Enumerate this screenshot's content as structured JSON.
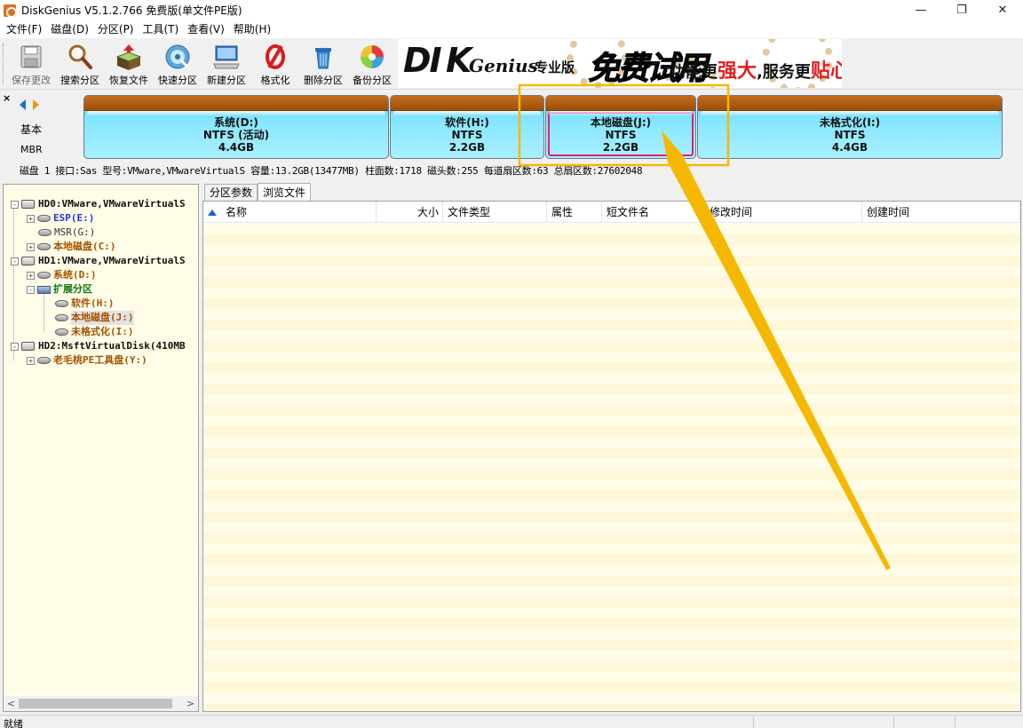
{
  "window": {
    "title": "DiskGenius V5.1.2.766 免费版(单文件PE版)",
    "controls": {
      "minimize": "—",
      "maximize": "❐",
      "close": "✕"
    }
  },
  "menu": [
    "文件(F)",
    "磁盘(D)",
    "分区(P)",
    "工具(T)",
    "查看(V)",
    "帮助(H)"
  ],
  "toolbar": {
    "items": [
      {
        "label": "保存更改",
        "icon": "save-icon",
        "enabled": false
      },
      {
        "label": "搜索分区",
        "icon": "magnifier-icon",
        "enabled": true
      },
      {
        "label": "恢复文件",
        "icon": "recover-box-icon",
        "enabled": true
      },
      {
        "label": "快速分区",
        "icon": "disc-icon",
        "enabled": true
      },
      {
        "label": "新建分区",
        "icon": "computer-icon",
        "enabled": true
      },
      {
        "label": "格式化",
        "icon": "format-icon",
        "enabled": true
      },
      {
        "label": "删除分区",
        "icon": "trash-icon",
        "enabled": true
      },
      {
        "label": "备份分区",
        "icon": "pie-icon",
        "enabled": true
      }
    ]
  },
  "banner": {
    "logo_di": "DI",
    "logo_k": "K",
    "logo_genius": "Genius",
    "edition": "专业版",
    "trial": "免费试用",
    "slogan_a": "功能更",
    "slogan_b": "强大",
    "slogan_c": ",服务更",
    "slogan_d": "贴心"
  },
  "disk_map": {
    "close": "×",
    "type": "基本",
    "style": "MBR",
    "partitions": [
      {
        "name": "系统(D:)",
        "fs": "NTFS (活动)",
        "size": "4.4GB",
        "selected": false
      },
      {
        "name": "软件(H:)",
        "fs": "NTFS",
        "size": "2.2GB",
        "selected": false
      },
      {
        "name": "本地磁盘(J:)",
        "fs": "NTFS",
        "size": "2.2GB",
        "selected": true
      },
      {
        "name": "未格式化(I:)",
        "fs": "NTFS",
        "size": "4.4GB",
        "selected": false
      }
    ],
    "info_line": "磁盘 1 接口:Sas  型号:VMware,VMwareVirtualS  容量:13.2GB(13477MB)  柱面数:1718  磁头数:255  每道扇区数:63  总扇区数:27602048"
  },
  "tree": [
    {
      "label": "HD0:VMware,VMwareVirtualS",
      "color": "black",
      "icon": "disk",
      "exp": "-"
    },
    {
      "label": "ESP(E:)",
      "color": "blue",
      "icon": "part",
      "exp": "+"
    },
    {
      "label": "MSR(G:)",
      "color": "gray",
      "icon": "part",
      "exp": ""
    },
    {
      "label": "本地磁盘(C:)",
      "color": "brown",
      "icon": "part",
      "exp": "+"
    },
    {
      "label": "HD1:VMware,VMwareVirtualS",
      "color": "black",
      "icon": "disk",
      "exp": "-"
    },
    {
      "label": "系统(D:)",
      "color": "brown",
      "icon": "part",
      "exp": "+"
    },
    {
      "label": "扩展分区",
      "color": "green",
      "icon": "ext",
      "exp": "-"
    },
    {
      "label": "软件(H:)",
      "color": "brown",
      "icon": "part",
      "exp": ""
    },
    {
      "label": "本地磁盘(J:)",
      "color": "brown",
      "icon": "part",
      "exp": "",
      "selected": true
    },
    {
      "label": "未格式化(I:)",
      "color": "brown",
      "icon": "part",
      "exp": ""
    },
    {
      "label": "HD2:MsftVirtualDisk(410MB",
      "color": "black",
      "icon": "disk",
      "exp": "-"
    },
    {
      "label": "老毛桃PE工具盘(Y:)",
      "color": "brown",
      "icon": "part",
      "exp": "+"
    }
  ],
  "tabs": [
    "分区参数",
    "浏览文件"
  ],
  "active_tab": "浏览文件",
  "columns": [
    "名称",
    "大小",
    "文件类型",
    "属性",
    "短文件名",
    "修改时间",
    "创建时间"
  ],
  "status": {
    "text": "就绪"
  },
  "colors": {
    "annotation_yellow": "#f5b800",
    "selection_pink": "#e0207a",
    "partition_cyan": "#6fdcfa",
    "partition_bar": "#b45f12"
  }
}
